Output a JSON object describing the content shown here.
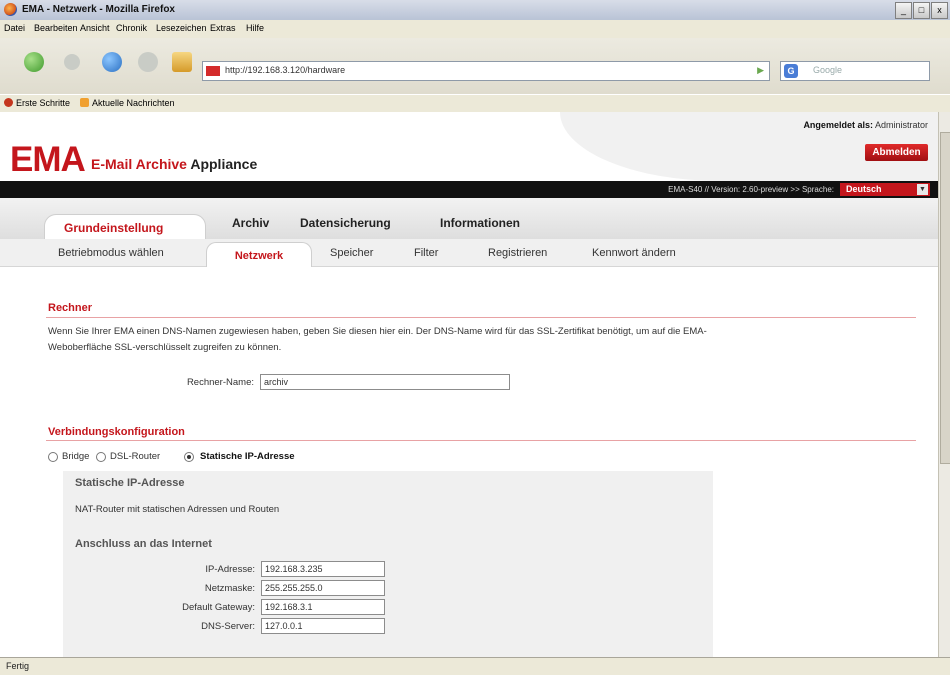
{
  "window": {
    "title": "EMA - Netzwerk - Mozilla Firefox",
    "buttons": [
      "_",
      "□",
      "x"
    ]
  },
  "menu": [
    "Datei",
    "Bearbeiten",
    "Ansicht",
    "Chronik",
    "Lesezeichen",
    "Extras",
    "Hilfe"
  ],
  "navbar": {
    "url": "http://192.168.3.120/hardware",
    "search_placeholder": "Google",
    "search_engine_icon": "G"
  },
  "bookmarks": [
    "Erste Schritte",
    "Aktuelle Nachrichten"
  ],
  "status": "Fertig",
  "header": {
    "logo": "EMA",
    "logo_sub_red": "E-Mail Archive",
    "logo_sub_black": "Appliance",
    "logged_in_label": "Angemeldet als:",
    "logged_in_user": "Administrator",
    "logout": "Abmelden",
    "version": "EMA-S40 // Version: 2.60-preview >> Sprache:",
    "language": "Deutsch",
    "language_dropdown": "▼"
  },
  "main_tabs": [
    "Grundeinstellung",
    "Archiv",
    "Datensicherung",
    "Informationen"
  ],
  "sub_tabs": [
    "Betriebmodus wählen",
    "Netzwerk",
    "Speicher",
    "Filter",
    "Registrieren",
    "Kennwort ändern"
  ],
  "rechner": {
    "title": "Rechner",
    "description": "Wenn Sie Ihrer EMA einen DNS-Namen zugewiesen haben, geben Sie diesen hier ein. Der DNS-Name wird für das SSL-Zertifikat benötigt, um auf die EMA-Weboberfläche SSL-verschlüsselt zugreifen zu können.",
    "name_label": "Rechner-Name:",
    "name_value": "archiv"
  },
  "verbindung": {
    "title": "Verbindungskonfiguration",
    "options": [
      "Bridge",
      "DSL-Router",
      "Statische IP-Adresse"
    ],
    "selected": "Statische IP-Adresse"
  },
  "static_panel": {
    "title": "Statische IP-Adresse",
    "description": "NAT-Router mit statischen Adressen und Routen",
    "subtitle": "Anschluss an das Internet",
    "fields": [
      {
        "label": "IP-Adresse:",
        "value": "192.168.3.235"
      },
      {
        "label": "Netzmaske:",
        "value": "255.255.255.0"
      },
      {
        "label": "Default Gateway:",
        "value": "192.168.3.1"
      },
      {
        "label": "DNS-Server:",
        "value": "127.0.0.1"
      }
    ]
  },
  "colors": {
    "brand_red": "#c4161c",
    "black_bar": "#111111"
  }
}
